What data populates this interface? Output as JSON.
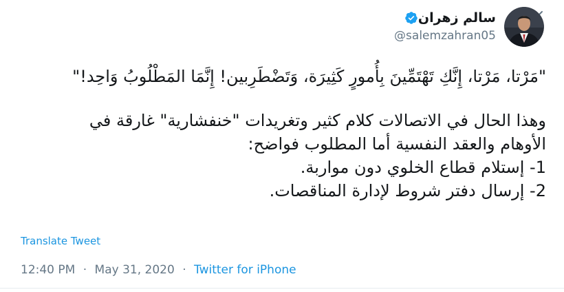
{
  "tweet": {
    "display_name": "سالم زهران",
    "handle": "@salemzahran05",
    "verified": true,
    "lines": [
      "\"مَرْتا، مَرْتا، إِنَّكِ تَهْتَمِّينَ بِأُمورٍ كَثِيرَة، وَتَضْطَرِبين! إِنَّمَا المَطْلُوبُ وَاحِد!\"",
      "",
      "وهذا الحال في الاتصالات كلام كثير وتغريدات \"خنفشارية\" غارقة في",
      "الأوهام والعقد النفسية أما المطلوب فواضح:",
      "1- إستلام قطاع الخلوي دون مواربة.",
      "2- إرسال دفتر شروط لإدارة المناقصات."
    ],
    "translate_label": "Translate Tweet",
    "time": "12:40 PM",
    "date": "May 31, 2020",
    "separator": "·",
    "source": "Twitter for iPhone"
  },
  "icons": {
    "menu": "chevron-down-icon",
    "verified": "verified-badge-icon",
    "avatar": "avatar"
  },
  "colors": {
    "link": "#1b95e0",
    "muted": "#657786",
    "text": "#14171a",
    "verified": "#1da1f2"
  }
}
